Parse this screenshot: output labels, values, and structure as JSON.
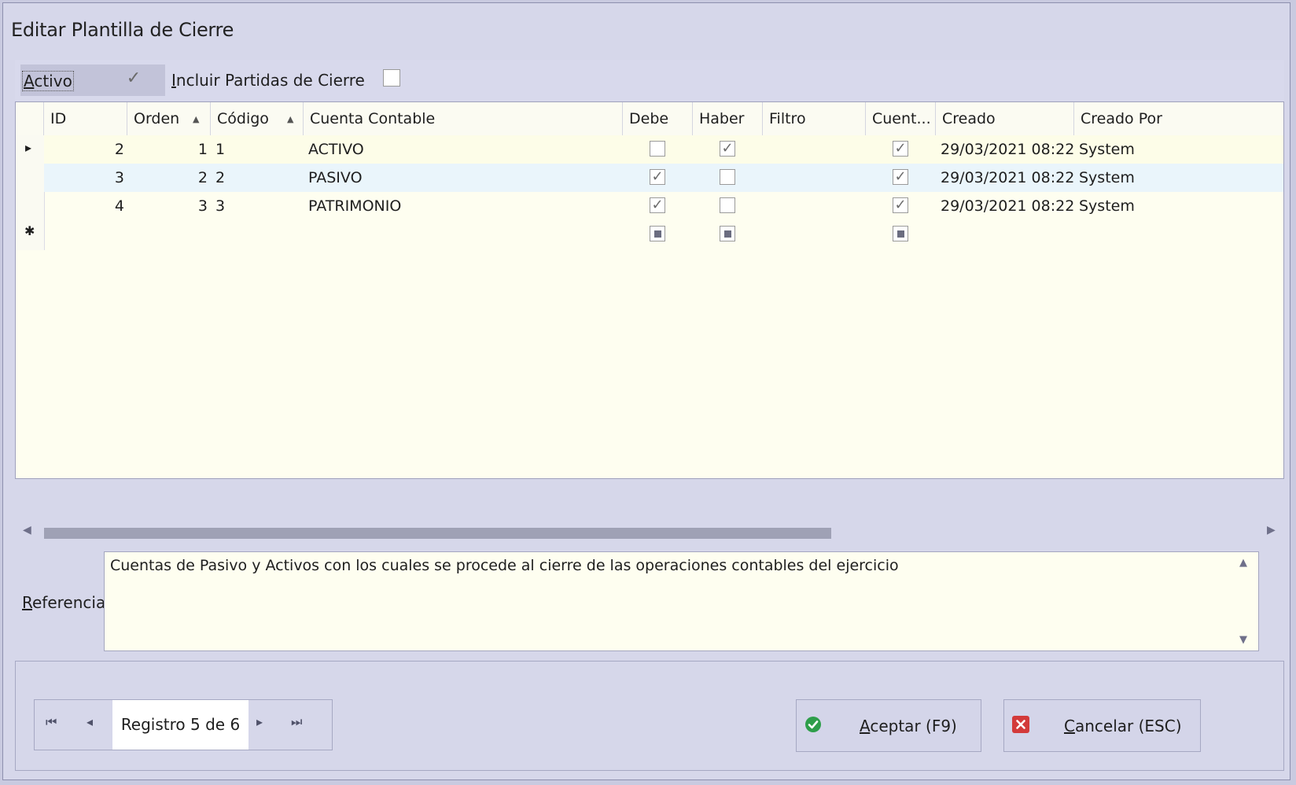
{
  "window": {
    "title": "Editar Plantilla de Cierre"
  },
  "options": {
    "activo_label_first": "A",
    "activo_label_rest": "ctivo",
    "activo_checked": true,
    "incluir_label_first": "I",
    "incluir_label_rest": "ncluir Partidas de Cierre",
    "incluir_checked": false
  },
  "grid": {
    "columns": [
      "ID",
      "Orden",
      "Código",
      "Cuenta Contable",
      "Debe",
      "Haber",
      "Filtro",
      "Cuent...",
      "Creado",
      "Creado Por"
    ],
    "rows": [
      {
        "id": "2",
        "orden": "1",
        "codigo": "1",
        "cuenta": "ACTIVO",
        "debe": false,
        "haber": true,
        "filtro": "",
        "cuent": true,
        "creado": "29/03/2021 08:22",
        "creado_por": "System"
      },
      {
        "id": "3",
        "orden": "2",
        "codigo": "2",
        "cuenta": "PASIVO",
        "debe": true,
        "haber": false,
        "filtro": "",
        "cuent": true,
        "creado": "29/03/2021 08:22",
        "creado_por": "System"
      },
      {
        "id": "4",
        "orden": "3",
        "codigo": "3",
        "cuenta": "PATRIMONIO",
        "debe": true,
        "haber": false,
        "filtro": "",
        "cuent": true,
        "creado": "29/03/2021 08:22",
        "creado_por": "System"
      }
    ],
    "current_row_marker": "▸",
    "new_row_marker": "✱"
  },
  "reference": {
    "label_first": "R",
    "label_rest": "eferencia",
    "text": "Cuentas de Pasivo y Activos con los cuales se procede al cierre de las operaciones contables del ejercicio"
  },
  "navigator": {
    "record_text": "Registro 5 de 6"
  },
  "buttons": {
    "accept_first": "A",
    "accept_rest": "ceptar (F9)",
    "cancel_first": "C",
    "cancel_rest": "ancelar (ESC)"
  },
  "colors": {
    "selected_row": "#fdfde8",
    "alt_row": "#eaf5fb",
    "accept_icon": "#2e9e4a",
    "cancel_icon": "#d33a3a"
  }
}
